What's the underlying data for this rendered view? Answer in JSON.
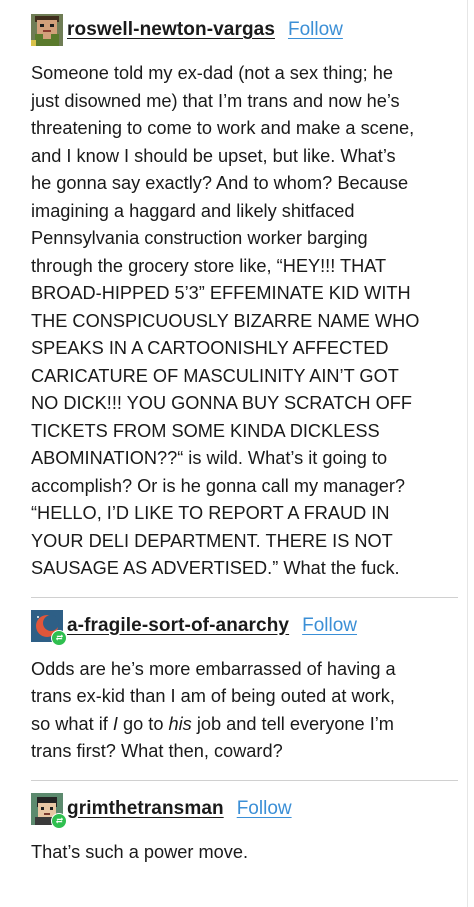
{
  "posts": [
    {
      "username": "roswell-newton-vargas",
      "follow_label": "Follow",
      "lines": [
        "Someone told my ex-dad (not a sex thing; he",
        "just disowned me) that I’m trans and now he’s",
        "threatening to come to work and make a scene,",
        "and I know I should be upset, but like. What’s",
        "he gonna say exactly? And to whom? Because",
        "imagining a haggard and likely shitfaced",
        "Pennsylvania construction worker barging",
        "through the grocery store like, “HEY!!! THAT",
        "BROAD-HIPPED 5’3” EFFEMINATE KID WITH",
        "THE CONSPICUOUSLY BIZARRE NAME WHO",
        "SPEAKS IN A CARTOONISHLY AFFECTED",
        "CARICATURE OF MASCULINITY AIN’T GOT",
        "NO DICK!!! YOU GONNA BUY SCRATCH OFF",
        "TICKETS FROM SOME KINDA DICKLESS",
        "ABOMINATION??“ is wild. What’s it going to",
        "accomplish? Or is he gonna call my manager?",
        "“HELLO, I’D LIKE TO REPORT A FRAUD IN",
        "YOUR DELI DEPARTMENT. THERE IS NOT",
        "SAUSAGE AS ADVERTISED.” What the fuck."
      ]
    },
    {
      "username": "a-fragile-sort-of-anarchy",
      "follow_label": "Follow",
      "lines": [
        "Odds are he’s more embarrassed of having a",
        "trans ex-kid than I am of being outed at work,",
        {
          "parts": [
            "so what if ",
            "I",
            " go to ",
            "his",
            " job and tell everyone I’m"
          ]
        },
        "trans first? What then, coward?"
      ]
    },
    {
      "username": "grimthetransman",
      "follow_label": "Follow",
      "lines": [
        "That’s such a power move."
      ]
    }
  ],
  "colors": {
    "text": "#1a1a1a",
    "link": "#3b8fd6",
    "divider": "#d0d0d0",
    "reblog_badge": "#2fbf4f"
  },
  "icons": {
    "post1_avatar": "pixel-art-avatar-icon",
    "post2_avatar": "planet-avatar-icon",
    "post3_avatar": "cartoon-face-avatar-icon",
    "reblog": "reblog-icon"
  }
}
